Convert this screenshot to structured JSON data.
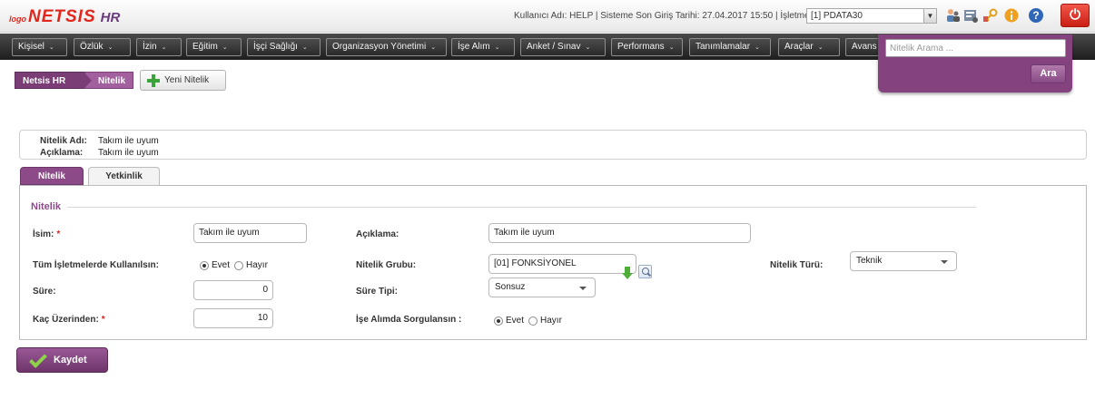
{
  "header": {
    "logo_prefix": "logo",
    "logo_name": "NETSIS",
    "logo_suffix": "HR",
    "user_info": "Kullanıcı Adı: HELP | Sisteme Son Giriş Tarihi: 27.04.2017 15:50 | İşletme:",
    "company_value": "[1] PDATA30",
    "icons": [
      "users-icon",
      "report-icon",
      "key-icon",
      "info-icon",
      "help-icon",
      "power-icon"
    ]
  },
  "menu": {
    "items": [
      {
        "label": "Kişisel"
      },
      {
        "label": "Özlük"
      },
      {
        "label": "İzin"
      },
      {
        "label": "Eğitim"
      },
      {
        "label": "İşçi Sağlığı"
      },
      {
        "label": "Organizasyon Yönetimi"
      },
      {
        "label": "İşe Alım"
      },
      {
        "label": "Anket / Sınav"
      },
      {
        "label": "Performans"
      },
      {
        "label": "Tanımlamalar"
      },
      {
        "label": "Araçlar"
      },
      {
        "label": "Avans"
      }
    ]
  },
  "search": {
    "placeholder": "Nitelik Arama ...",
    "button_label": "Ara"
  },
  "breadcrumb": {
    "root": "Netsis HR",
    "current": "Nitelik"
  },
  "toolbar": {
    "new_label": "Yeni Nitelik"
  },
  "summary": {
    "name_label": "Nitelik Adı:",
    "name_value": "Takım ile uyum",
    "desc_label": "Açıklama:",
    "desc_value": "Takım ile uyum"
  },
  "tabs": {
    "active": "Nitelik",
    "inactive": "Yetkinlik"
  },
  "form": {
    "section_title": "Nitelik",
    "isim_label": "İsim:",
    "isim_required": "*",
    "isim_value": "Takım ile uyum",
    "aciklama_label": "Açıklama:",
    "aciklama_value": "Takım ile uyum",
    "tum_label": "Tüm İşletmelerde Kullanılsın:",
    "evet": "Evet",
    "hayir": "Hayır",
    "grup_label": "Nitelik Grubu:",
    "grup_value": "[01] FONKSİYONEL",
    "tur_label": "Nitelik Türü:",
    "tur_value": "Teknik",
    "sure_label": "Süre:",
    "sure_value": "0",
    "sure_tipi_label": "Süre Tipi:",
    "sure_tipi_value": "Sonsuz",
    "kac_label": "Kaç Üzerinden:",
    "kac_required": "*",
    "kac_value": "10",
    "ise_alim_label": "İşe Alımda Sorgulansın :",
    "tum_selected": "Evet",
    "ise_alim_selected": "Evet"
  },
  "actions": {
    "save_label": "Kaydet"
  }
}
